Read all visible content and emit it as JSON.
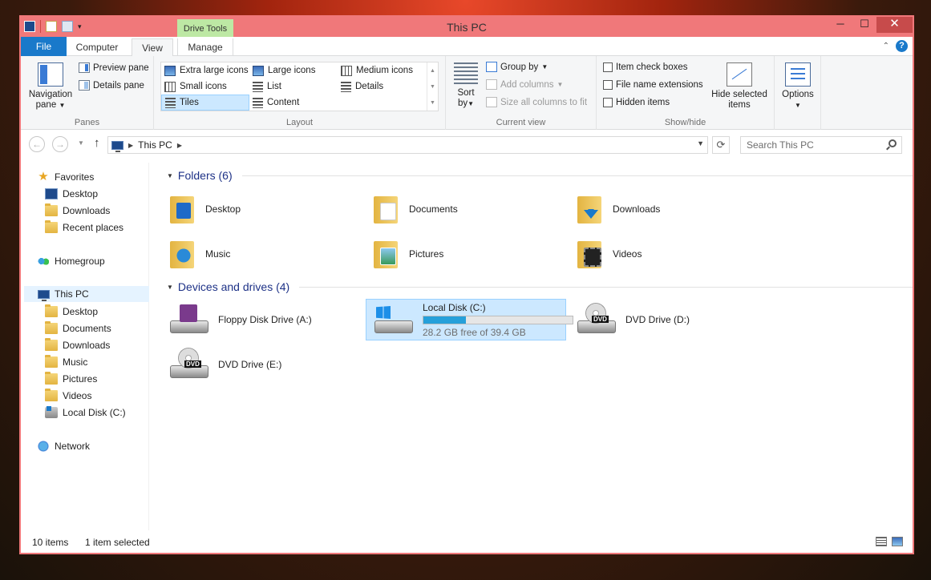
{
  "window": {
    "title": "This PC",
    "context_tab": "Drive Tools"
  },
  "tabs": {
    "file": "File",
    "computer": "Computer",
    "view": "View",
    "manage": "Manage"
  },
  "ribbon": {
    "panes": {
      "label": "Panes",
      "navigation_pane": "Navigation",
      "navigation_pane_line2": "pane",
      "preview_pane": "Preview pane",
      "details_pane": "Details pane"
    },
    "layout": {
      "label": "Layout",
      "items": [
        {
          "label": "Extra large icons",
          "selected": false
        },
        {
          "label": "Large icons",
          "selected": false
        },
        {
          "label": "Medium icons",
          "selected": false
        },
        {
          "label": "Small icons",
          "selected": false
        },
        {
          "label": "List",
          "selected": false
        },
        {
          "label": "Details",
          "selected": false
        },
        {
          "label": "Tiles",
          "selected": true
        },
        {
          "label": "Content",
          "selected": false
        }
      ]
    },
    "current_view": {
      "label": "Current view",
      "sort_by": "Sort",
      "sort_by_line2": "by",
      "group_by": "Group by",
      "add_columns": "Add columns",
      "size_all_columns": "Size all columns to fit"
    },
    "show_hide": {
      "label": "Show/hide",
      "item_check_boxes": "Item check boxes",
      "file_name_extensions": "File name extensions",
      "hidden_items": "Hidden items",
      "hide_selected": "Hide selected",
      "hide_selected_line2": "items"
    },
    "options": "Options"
  },
  "address": {
    "crumb": "This PC",
    "search_placeholder": "Search This PC"
  },
  "navpane": {
    "favorites": "Favorites",
    "fav_items": [
      "Desktop",
      "Downloads",
      "Recent places"
    ],
    "homegroup": "Homegroup",
    "this_pc": "This PC",
    "pc_items": [
      "Desktop",
      "Documents",
      "Downloads",
      "Music",
      "Pictures",
      "Videos",
      "Local Disk (C:)"
    ],
    "network": "Network"
  },
  "main": {
    "folders_header": "Folders (6)",
    "folders": [
      "Desktop",
      "Documents",
      "Downloads",
      "Music",
      "Pictures",
      "Videos"
    ],
    "devices_header": "Devices and drives (4)",
    "drives": {
      "floppy": "Floppy Disk Drive (A:)",
      "local_disk": "Local Disk (C:)",
      "local_disk_free": "28.2 GB free of 39.4 GB",
      "local_disk_used_fraction": 0.284,
      "dvd_d": "DVD Drive (D:)",
      "dvd_e": "DVD Drive (E:)",
      "dvd_badge": "DVD"
    }
  },
  "status": {
    "items": "10 items",
    "selected": "1 item selected"
  }
}
